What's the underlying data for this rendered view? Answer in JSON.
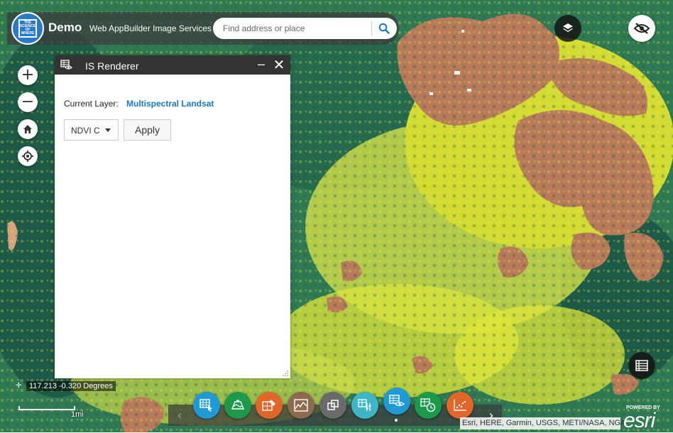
{
  "header": {
    "logo_text": "THE SCIENCE OF WHERE",
    "title": "Demo",
    "subtitle": "Web AppBuilder Image Services"
  },
  "search": {
    "placeholder": "Find address or place"
  },
  "map_controls": {
    "zoom_in": "+",
    "zoom_out": "−"
  },
  "panel": {
    "title": "IS Renderer",
    "current_layer_label": "Current Layer:",
    "current_layer_value": "Multispectral Landsat",
    "renderer_selected": "NDVI Colorized",
    "apply_label": "Apply"
  },
  "status": {
    "coordinates": "117.213 -0.320 Degrees",
    "scale_label": "1mi"
  },
  "toolbar": {
    "prev": "‹",
    "next": "›",
    "buttons": [
      {
        "name": "image-selector-button",
        "color": "#1f9ad6"
      },
      {
        "name": "change-detection-button",
        "color": "#1b9a4b"
      },
      {
        "name": "classification-button",
        "color": "#e2662a"
      },
      {
        "name": "profile-button",
        "color": "#8b6a4f"
      },
      {
        "name": "compare-button",
        "color": "#6a6a6a"
      },
      {
        "name": "bands-button",
        "color": "#3fb6c8"
      },
      {
        "name": "renderer-button",
        "color": "#1f9ad6"
      },
      {
        "name": "time-button",
        "color": "#1b9a4b"
      },
      {
        "name": "scatterplot-button",
        "color": "#e2662a"
      }
    ]
  },
  "attribution": "Esri, HERE, Garmin, USGS, METI/NASA, NGA",
  "branding": {
    "powered_by": "POWERED BY",
    "esri": "esri"
  },
  "colors": {
    "vegetation_dark": "#1e5a48",
    "vegetation_mid": "#2f8a56",
    "vegetation_light": "#c9d94a",
    "vegetation_yellow": "#e8ee2c",
    "bare_ground": "#b87a5a",
    "accent_blue": "#1a78c2"
  }
}
